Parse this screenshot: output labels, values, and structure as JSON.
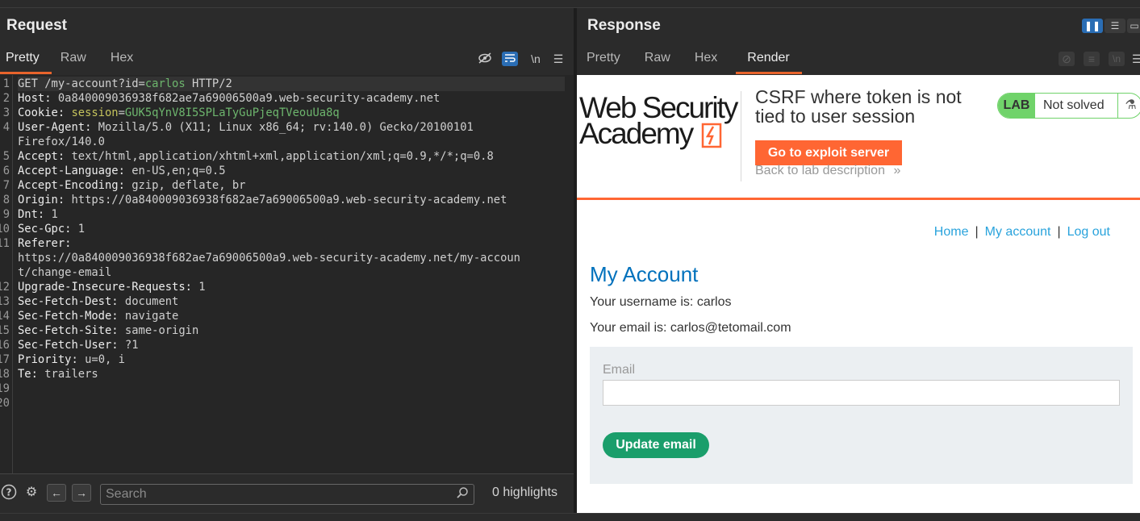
{
  "request": {
    "title": "Request",
    "tabs": [
      "Pretty",
      "Raw",
      "Hex"
    ],
    "active_tab": "Pretty",
    "newline_toggle": "\\n",
    "lines": [
      {
        "n": "1",
        "parts": [
          [
            "",
            "GET /my-account?id="
          ],
          [
            "pv",
            "carlos"
          ],
          [
            "",
            " HTTP/2"
          ]
        ]
      },
      {
        "n": "2",
        "parts": [
          [
            "hn",
            "Host: "
          ],
          [
            "hv",
            "0a840009036938f682ae7a69006500a9.web-security-academy.net"
          ]
        ]
      },
      {
        "n": "3",
        "parts": [
          [
            "hn",
            "Cookie: "
          ],
          [
            "kv",
            "session"
          ],
          [
            "hv",
            "="
          ],
          [
            "pv",
            "GUK5qYnV8I5SPLaTyGuPjeqTVeouUa8q"
          ]
        ]
      },
      {
        "n": "4",
        "parts": [
          [
            "hn",
            "User-Agent: "
          ],
          [
            "hv",
            "Mozilla/5.0 (X11; Linux x86_64; rv:140.0) Gecko/20100101"
          ]
        ]
      },
      {
        "n": "",
        "parts": [
          [
            "hv",
            "Firefox/140.0"
          ]
        ]
      },
      {
        "n": "5",
        "parts": [
          [
            "hn",
            "Accept: "
          ],
          [
            "hv",
            "text/html,application/xhtml+xml,application/xml;q=0.9,*/*;q=0.8"
          ]
        ]
      },
      {
        "n": "6",
        "parts": [
          [
            "hn",
            "Accept-Language: "
          ],
          [
            "hv",
            "en-US,en;q=0.5"
          ]
        ]
      },
      {
        "n": "7",
        "parts": [
          [
            "hn",
            "Accept-Encoding: "
          ],
          [
            "hv",
            "gzip, deflate, br"
          ]
        ]
      },
      {
        "n": "8",
        "parts": [
          [
            "hn",
            "Origin: "
          ],
          [
            "hv",
            "https://0a840009036938f682ae7a69006500a9.web-security-academy.net"
          ]
        ]
      },
      {
        "n": "9",
        "parts": [
          [
            "hn",
            "Dnt: "
          ],
          [
            "hv",
            "1"
          ]
        ]
      },
      {
        "n": "10",
        "parts": [
          [
            "hn",
            "Sec-Gpc: "
          ],
          [
            "hv",
            "1"
          ]
        ]
      },
      {
        "n": "11",
        "parts": [
          [
            "hn",
            "Referer: "
          ]
        ]
      },
      {
        "n": "",
        "parts": [
          [
            "hv",
            "https://0a840009036938f682ae7a69006500a9.web-security-academy.net/my-accoun"
          ]
        ]
      },
      {
        "n": "",
        "parts": [
          [
            "hv",
            "t/change-email"
          ]
        ]
      },
      {
        "n": "12",
        "parts": [
          [
            "hn",
            "Upgrade-Insecure-Requests: "
          ],
          [
            "hv",
            "1"
          ]
        ]
      },
      {
        "n": "13",
        "parts": [
          [
            "hn",
            "Sec-Fetch-Dest: "
          ],
          [
            "hv",
            "document"
          ]
        ]
      },
      {
        "n": "14",
        "parts": [
          [
            "hn",
            "Sec-Fetch-Mode: "
          ],
          [
            "hv",
            "navigate"
          ]
        ]
      },
      {
        "n": "15",
        "parts": [
          [
            "hn",
            "Sec-Fetch-Site: "
          ],
          [
            "hv",
            "same-origin"
          ]
        ]
      },
      {
        "n": "16",
        "parts": [
          [
            "hn",
            "Sec-Fetch-User: "
          ],
          [
            "hv",
            "?1"
          ]
        ]
      },
      {
        "n": "17",
        "parts": [
          [
            "hn",
            "Priority: "
          ],
          [
            "hv",
            "u=0, i"
          ]
        ]
      },
      {
        "n": "18",
        "parts": [
          [
            "hn",
            "Te: "
          ],
          [
            "hv",
            "trailers"
          ]
        ]
      },
      {
        "n": "19",
        "parts": []
      },
      {
        "n": "20",
        "parts": []
      }
    ],
    "search_placeholder": "Search",
    "highlights": "0 highlights"
  },
  "response": {
    "title": "Response",
    "tabs": [
      "Pretty",
      "Raw",
      "Hex",
      "Render"
    ],
    "active_tab": "Render",
    "render": {
      "logo_line1": "Web Security",
      "logo_line2": "Academy",
      "lab_title": "CSRF where token is not tied to user session",
      "exploit_button": "Go to exploit server",
      "back_link": "Back to lab description",
      "lab_badge": "LAB",
      "lab_status": "Not solved",
      "nav": {
        "home": "Home",
        "my_account": "My account",
        "logout": "Log out",
        "sep": "|"
      },
      "page_title": "My Account",
      "username_line": "Your username is: carlos",
      "email_line": "Your email is: carlos@tetomail.com",
      "email_label": "Email",
      "update_button": "Update email"
    }
  },
  "colors": {
    "accent_orange": "#e8642c",
    "toggle_blue": "#2a6db4",
    "lab_green": "#70d36a",
    "link_blue": "#29a3dc",
    "heading_blue": "#0071bc",
    "update_green": "#1a9e6b"
  }
}
